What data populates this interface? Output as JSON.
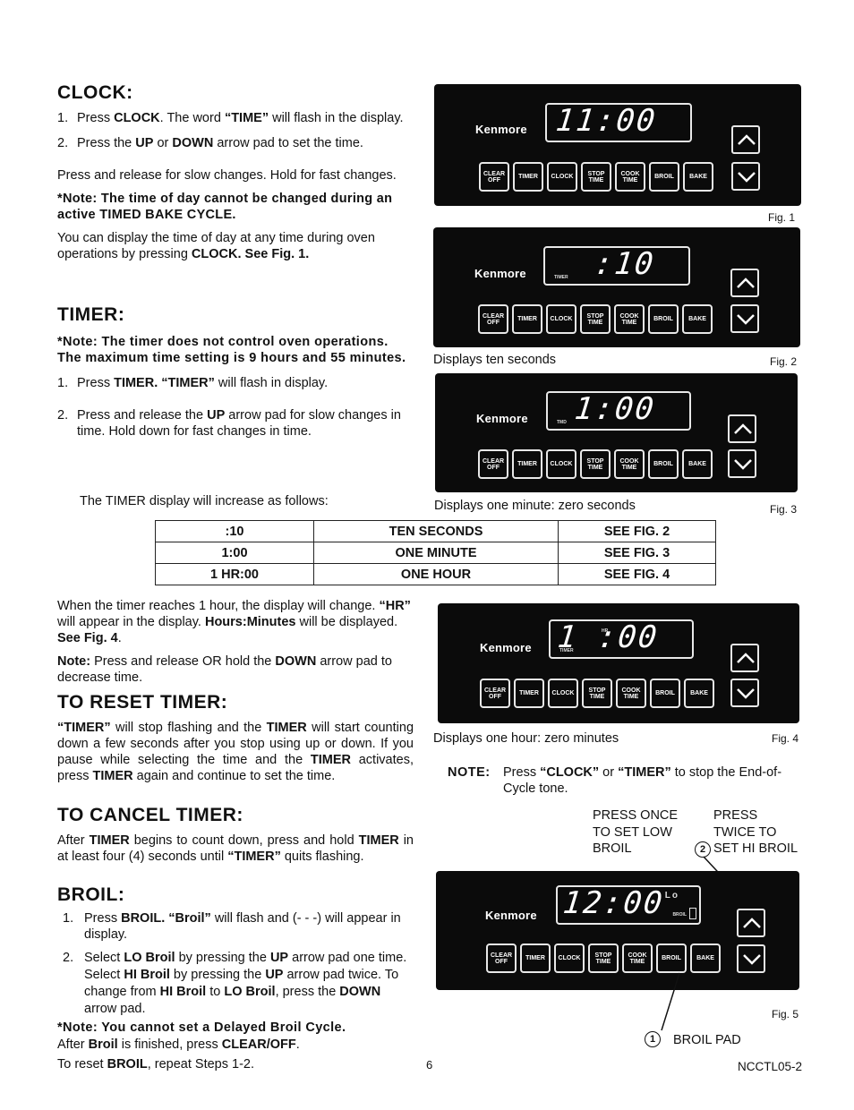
{
  "clock": {
    "heading": "CLOCK:",
    "step1_pre": "Press ",
    "step1_b1": "CLOCK",
    "step1_mid": ". The word ",
    "step1_b2": "“TIME”",
    "step1_post": " will flash in the display.",
    "step2_pre": "Press the ",
    "step2_b1": "UP",
    "step2_mid": " or ",
    "step2_b2": "DOWN",
    "step2_post": " arrow pad to set the time.",
    "para1": "Press and release for slow changes. Hold for fast changes.",
    "note": "*Note: The time of day cannot be changed during an active TIMED BAKE CYCLE.",
    "para2_pre": "You can display the time of day at any time during oven operations by pressing ",
    "para2_b": "CLOCK.  See Fig. 1."
  },
  "timer": {
    "heading": "TIMER:",
    "note_pre": "*Note: The timer does not control oven operations. ",
    "note_b": "The maximum time setting is 9 hours and 55 minutes.",
    "step1_pre": "Press ",
    "step1_b1": "TIMER.",
    "step1_b2": " “TIMER”",
    "step1_post": " will flash in display.",
    "step2_pre": "Press and release the ",
    "step2_b": "UP",
    "step2_post": " arrow pad for slow changes in time. Hold down for fast changes in time.",
    "increase_intro": "The TIMER display will increase as follows:",
    "table": [
      [
        ":10",
        "TEN  SECONDS",
        "SEE FIG. 2"
      ],
      [
        "1:00",
        "ONE MINUTE",
        "SEE FIG. 3"
      ],
      [
        "1 HR:00",
        "ONE HOUR",
        "SEE FIG. 4"
      ]
    ],
    "hour_para_1": "When the timer reaches 1 hour, the display will change. ",
    "hour_para_b1": "“HR”",
    "hour_para_2": " will appear in the display. ",
    "hour_para_b2": "Hours:Minutes",
    "hour_para_3": " will be displayed. ",
    "hour_para_b3": "See Fig. 4",
    "hour_para_4": ".",
    "down_note_b": "Note:",
    "down_note_1": " Press and release OR hold the ",
    "down_note_b2": "DOWN",
    "down_note_2": " arrow pad to decrease time."
  },
  "reset_timer": {
    "heading": "TO RESET TIMER:",
    "b1": "“TIMER”",
    "t1": " will stop flashing and the ",
    "b2": "TIMER",
    "t2": " will start counting down a few seconds after you stop using up or down.  If you pause while selecting the time and the ",
    "b3": "TIMER",
    "t3": " activates, press ",
    "b4": "TIMER",
    "t4": " again and continue to set the time."
  },
  "cancel_timer": {
    "heading": "TO CANCEL TIMER:",
    "t1": "After ",
    "b1": "TIMER",
    "t2": " begins to count down, press and hold ",
    "b2": "TIMER",
    "t3": " in at least four (4) seconds until ",
    "b3": "“TIMER”",
    "t4": " quits flashing."
  },
  "broil": {
    "heading": "BROIL:",
    "s1_pre": "Press ",
    "s1_b1": "BROIL.",
    "s1_mid": "  ",
    "s1_b2": "“Broil”",
    "s1_post": " will flash and (- - -) will appear in display.",
    "s2_1": "Select ",
    "s2_b1": "LO Broil",
    "s2_2": " by pressing the ",
    "s2_b2": "UP",
    "s2_3": " arrow pad one time. Select ",
    "s2_b3": "HI Broil",
    "s2_4": " by pressing the ",
    "s2_b4": "UP",
    "s2_5": " arrow pad twice.  To change from ",
    "s2_b5": "HI Broil",
    "s2_6": " to ",
    "s2_b6": "LO Broil",
    "s2_7": ", press the ",
    "s2_b7": "DOWN",
    "s2_8": " arrow pad.",
    "note": "*Note:  You cannot set a Delayed Broil Cycle.",
    "after_1": "After ",
    "after_b1": "Broil",
    "after_2": " is finished, press ",
    "after_b2": "CLEAR/OFF",
    "after_3": ".",
    "reset_1": "To reset ",
    "reset_b": "BROIL",
    "reset_2": ", repeat Steps 1-2."
  },
  "panel": {
    "brand": "Kenmore",
    "keys": [
      {
        "line1": "CLEAR",
        "line2": "OFF"
      },
      {
        "line1": "TIMER",
        "line2": ""
      },
      {
        "line1": "CLOCK",
        "line2": ""
      },
      {
        "line1": "STOP",
        "line2": "TIME"
      },
      {
        "line1": "COOK",
        "line2": "TIME"
      },
      {
        "line1": "BROIL",
        "line2": ""
      },
      {
        "line1": "BAKE",
        "line2": ""
      }
    ],
    "up_arrow": "up-arrow",
    "down_arrow": "down-arrow"
  },
  "figures": [
    {
      "label": "Fig. 1",
      "display": "11:00",
      "indicator": "",
      "caption": ""
    },
    {
      "label": "Fig. 2",
      "display": ":10",
      "indicator": "TIMER",
      "caption": "Displays ten seconds"
    },
    {
      "label": "Fig. 3",
      "display": "1:00",
      "indicator": "TMD",
      "caption": "Displays one minute: zero seconds"
    },
    {
      "label": "Fig. 4",
      "display": "1 :00",
      "indicator": "TIMER",
      "hr_indicator": "HR",
      "caption": "Displays one hour: zero minutes"
    },
    {
      "label": "Fig. 5",
      "display": "12:00",
      "lo_indicator": "Lo",
      "indicator": "BROIL",
      "caption": ""
    }
  ],
  "note_tone": {
    "label": "NOTE:",
    "t1": " Press ",
    "b1": "“CLOCK”",
    "t2": " or ",
    "b2": "“TIMER”",
    "t3": " to stop the End-of-Cycle tone."
  },
  "fig5_callouts": {
    "press_once": [
      "PRESS ONCE",
      "TO SET LOW",
      "BROIL"
    ],
    "press_twice": [
      "PRESS",
      "TWICE TO",
      "SET HI BROIL"
    ],
    "callout_2": "2",
    "callout_1": "1",
    "broil_pad": "BROIL PAD"
  },
  "footer": {
    "page_number": "6",
    "doc_code": "NCCTL05-2"
  }
}
